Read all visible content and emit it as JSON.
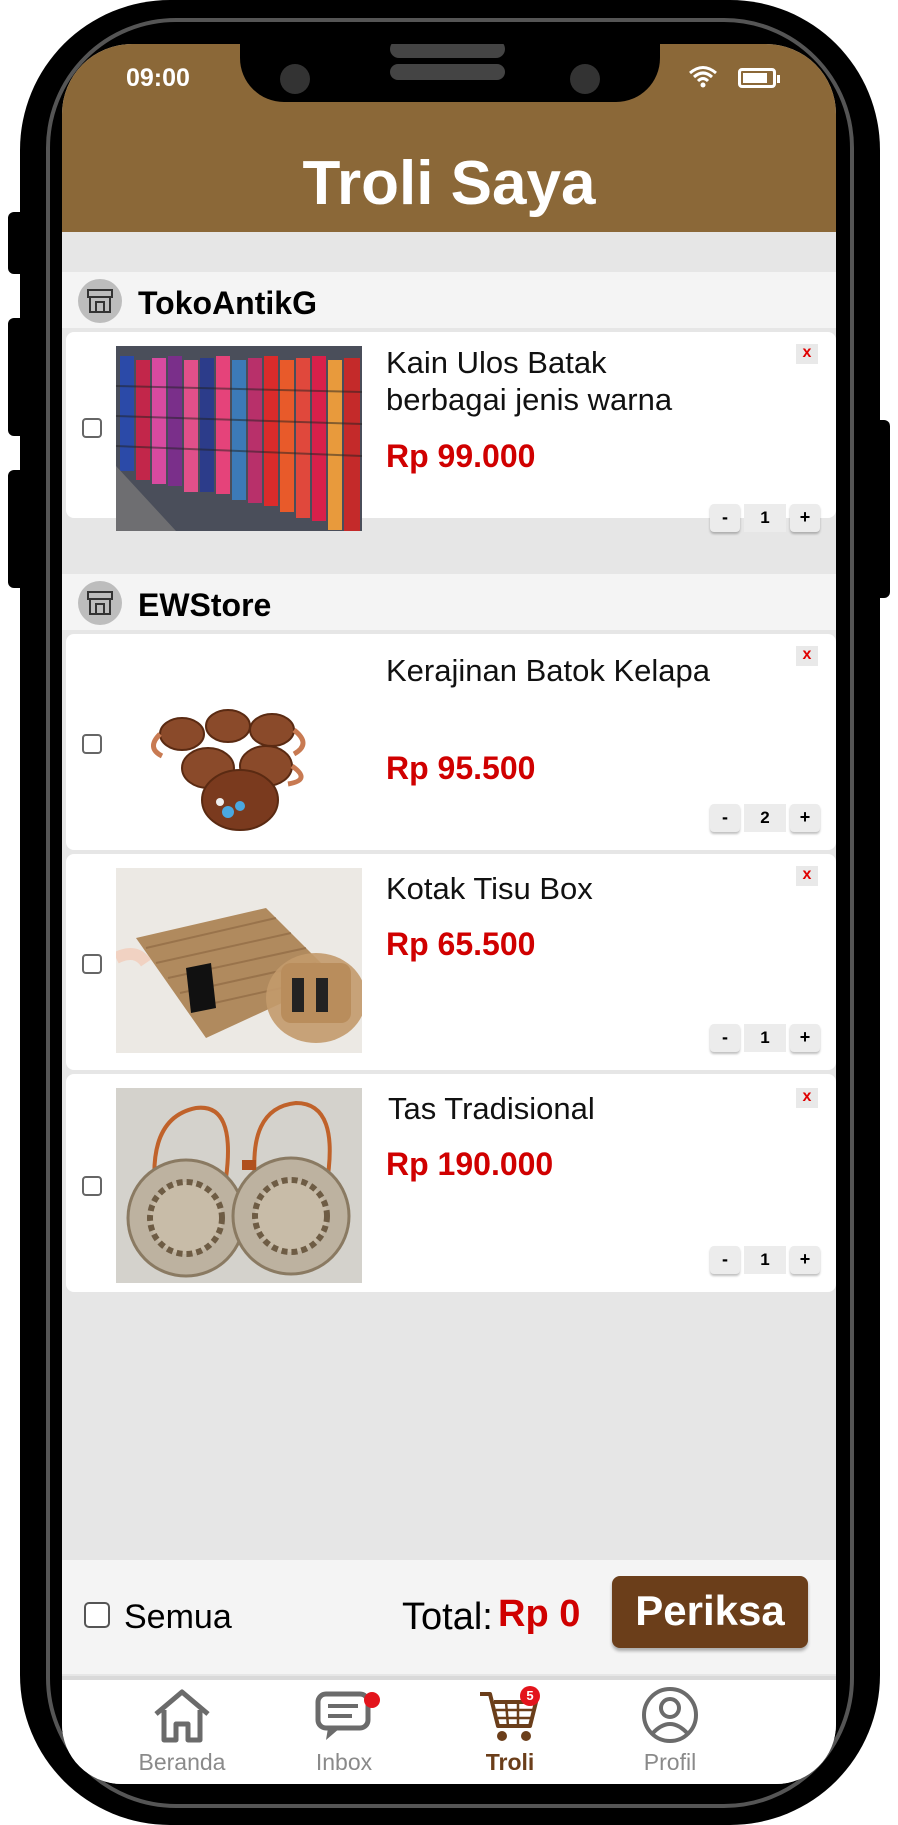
{
  "status_bar": {
    "time": "09:00"
  },
  "header": {
    "title": "Troli Saya"
  },
  "colors": {
    "header": "#8b6838",
    "price": "#d00000",
    "checkout": "#6b3e1a",
    "badge": "#e3141c"
  },
  "stores": [
    {
      "name": "TokoAntikG",
      "items": [
        {
          "name": "Kain Ulos Batak berbagai jenis warna",
          "price": "Rp 99.000",
          "qty": "1",
          "image": "colorful-woven-ulos-cloths"
        }
      ]
    },
    {
      "name": "EWStore",
      "items": [
        {
          "name": "Kerajinan Batok Kelapa",
          "price": "Rp 95.500",
          "qty": "2",
          "image": "coconut-shell-cups"
        },
        {
          "name": "Kotak Tisu Box",
          "price": "Rp 65.500",
          "qty": "1",
          "image": "woven-tissue-box"
        },
        {
          "name": "Tas Tradisional",
          "price": "Rp 190.000",
          "qty": "1",
          "image": "round-rattan-bags"
        }
      ]
    }
  ],
  "item_controls": {
    "delete": "x",
    "minus": "-",
    "plus": "+"
  },
  "footer": {
    "select_all": "Semua",
    "total_label": "Total:",
    "total_value": "Rp 0",
    "checkout": "Periksa"
  },
  "nav": {
    "items": [
      {
        "label": "Beranda",
        "icon": "home-icon"
      },
      {
        "label": "Inbox",
        "icon": "chat-icon"
      },
      {
        "label": "Troli",
        "icon": "cart-icon",
        "badge": "5"
      },
      {
        "label": "Profil",
        "icon": "user-icon"
      }
    ]
  }
}
